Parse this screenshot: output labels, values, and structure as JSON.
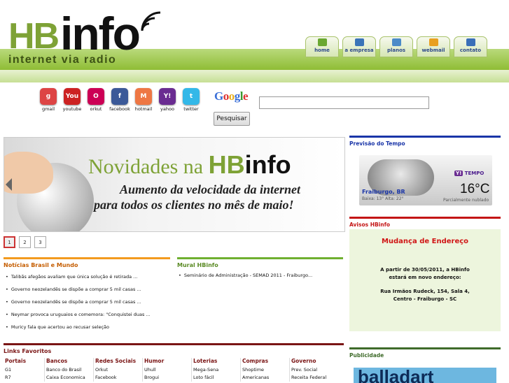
{
  "header": {
    "logo_main": "HB",
    "logo_info": "info",
    "tagline": "internet via radio",
    "nav": [
      {
        "label": "home",
        "icon": "house-icon",
        "color": "#6aa832"
      },
      {
        "label": "a empresa",
        "icon": "building-icon",
        "color": "#3a74b8"
      },
      {
        "label": "planos",
        "icon": "chart-icon",
        "color": "#4b8bc8"
      },
      {
        "label": "webmail",
        "icon": "mail-icon",
        "color": "#e8a020"
      },
      {
        "label": "contato",
        "icon": "phone-icon",
        "color": "#3a6fb8"
      }
    ]
  },
  "quicklinks": [
    {
      "label": "gmail",
      "icon": "gmail-icon",
      "glyph": "g",
      "color": "#d44"
    },
    {
      "label": "youtube",
      "icon": "youtube-icon",
      "glyph": "You",
      "color": "#c22"
    },
    {
      "label": "orkut",
      "icon": "orkut-icon",
      "glyph": "O",
      "color": "#c05"
    },
    {
      "label": "facebook",
      "icon": "facebook-icon",
      "glyph": "f",
      "color": "#3b5998"
    },
    {
      "label": "hotmail",
      "icon": "hotmail-icon",
      "glyph": "M",
      "color": "#e74"
    },
    {
      "label": "yahoo",
      "icon": "yahoo-icon",
      "glyph": "Y!",
      "color": "#6a2c91"
    },
    {
      "label": "twitter",
      "icon": "twitter-icon",
      "glyph": "t",
      "color": "#33b8e8"
    }
  ],
  "search": {
    "logo": "Google",
    "placeholder": "",
    "button": "Pesquisar"
  },
  "banner": {
    "line1": "Novidades na",
    "line1_brand_hb": "HB",
    "line1_brand_info": "info",
    "line2": "Aumento da velocidade da internet",
    "line3": "para todos os clientes no mês de maio!"
  },
  "pager": [
    "1",
    "2",
    "3"
  ],
  "news": {
    "title": "Notícias Brasil e Mundo",
    "items": [
      "Talibãs afegãos avaliam que única solução é retirada ...",
      "Governo neozelandês se dispõe a comprar 5 mil casas ...",
      "Governo neozelandês se dispõe a comprar 5 mil casas ...",
      "Neymar provoca uruguaios e comemora: \"Conquistei duas ...",
      "Muricy fala que acertou ao recusar seleção"
    ]
  },
  "mural": {
    "title": "Mural HBinfo",
    "items": [
      "Seminário de Administração - SEMAD 2011 - Fraiburgo..."
    ]
  },
  "links": {
    "title": "Links Favoritos",
    "columns": [
      {
        "head": "Portais",
        "items": [
          "G1",
          "R7"
        ]
      },
      {
        "head": "Bancos",
        "items": [
          "Banco do Brasil",
          "Caixa Economica"
        ]
      },
      {
        "head": "Redes Sociais",
        "items": [
          "Orkut",
          "Facebook"
        ]
      },
      {
        "head": "Humor",
        "items": [
          "Uhull",
          "Brogui"
        ]
      },
      {
        "head": "Loterias",
        "items": [
          "Mega-Sena",
          "Loto fácil"
        ]
      },
      {
        "head": "Compras",
        "items": [
          "Shoptime",
          "Americanas"
        ]
      },
      {
        "head": "Governo",
        "items": [
          "Prev. Social",
          "Receita Federal"
        ]
      }
    ]
  },
  "weather": {
    "title": "Previsão do Tempo",
    "provider": "TEMPO",
    "city": "Fraiburgo, BR",
    "minmax": "Baixa: 13°  Alta: 22°",
    "temp": "16°C",
    "condition": "Parcialmente nublado"
  },
  "avisos": {
    "title": "Avisos HBinfo",
    "headline": "Mudança de Endereço",
    "p1": "A partir de 30/05/2011, a HBinfo",
    "p2": "estará em novo endereço:",
    "p3": "Rua Irmãos Rudeck, 154, Sala 4,",
    "p4": "Centro - Fraiburgo - SC"
  },
  "publicidade": {
    "title": "Publicidade",
    "ad_text": "balladart"
  }
}
